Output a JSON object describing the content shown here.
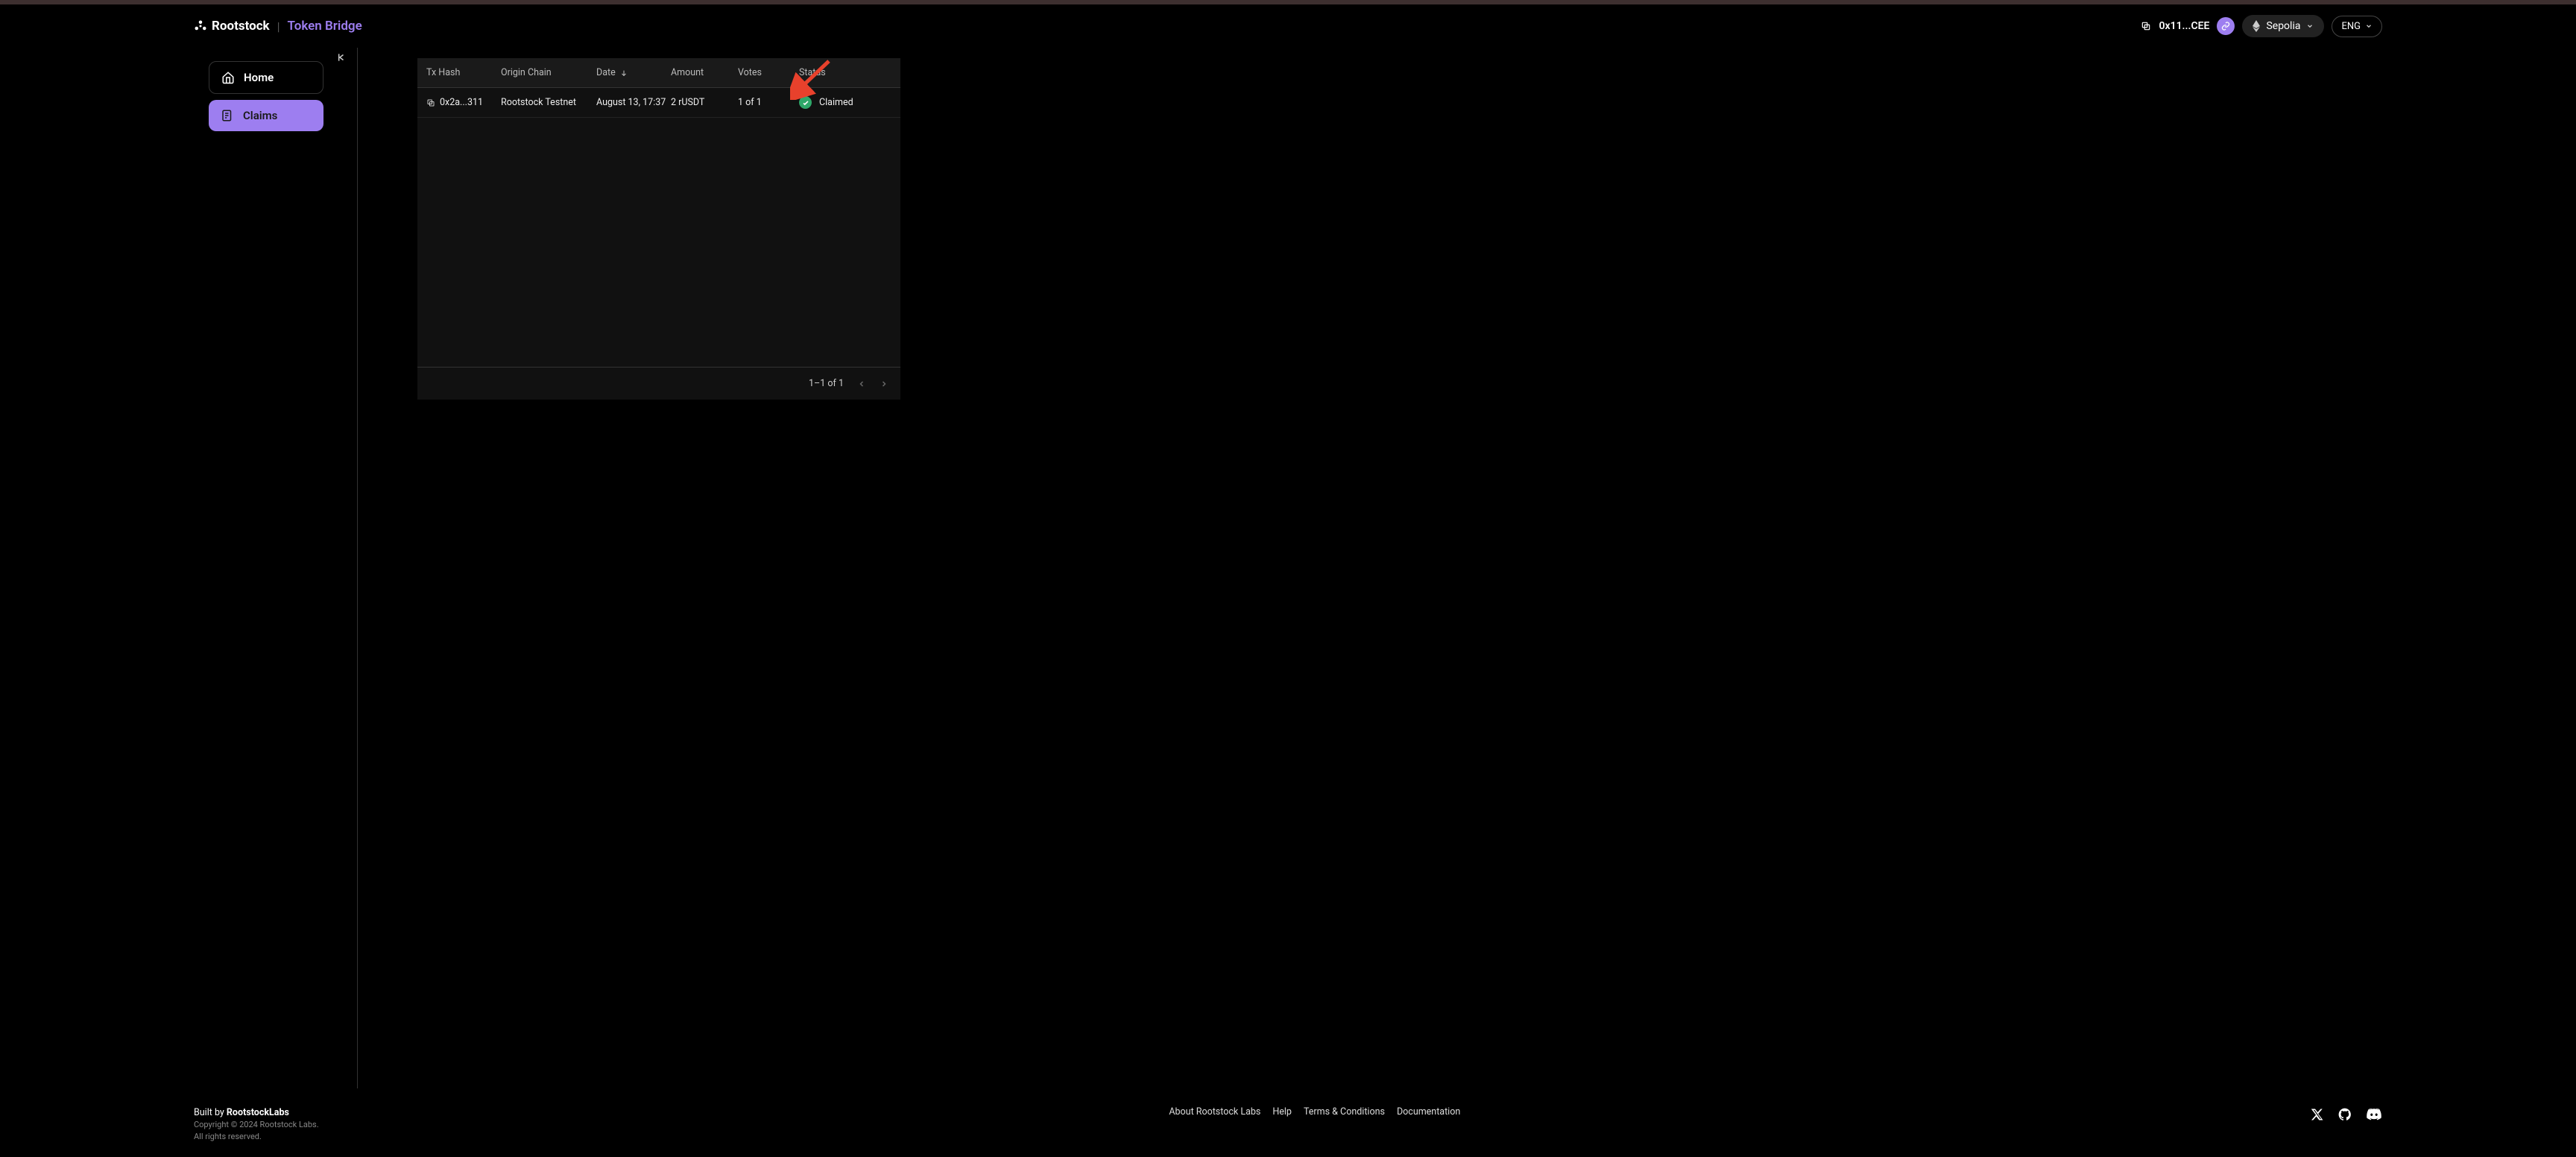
{
  "header": {
    "brand": "Rootstock",
    "app_name": "Token Bridge",
    "wallet_address": "0x11...CEE",
    "network_name": "Sepolia",
    "language": "ENG"
  },
  "sidebar": {
    "items": [
      {
        "label": "Home",
        "active": false
      },
      {
        "label": "Claims",
        "active": true
      }
    ]
  },
  "table": {
    "columns": {
      "tx_hash": "Tx Hash",
      "origin_chain": "Origin Chain",
      "date": "Date",
      "amount": "Amount",
      "votes": "Votes",
      "status": "Status"
    },
    "rows": [
      {
        "tx_hash": "0x2a...311",
        "origin_chain": "Rootstock Testnet",
        "date": "August 13, 17:37",
        "amount": "2 rUSDT",
        "votes": "1 of 1",
        "status": "Claimed"
      }
    ],
    "pagination": "1–1 of 1"
  },
  "footer": {
    "built_prefix": "Built by ",
    "built_brand": "RootstockLabs",
    "copyright": "Copyright © 2024 Rootstock Labs.",
    "rights": "All rights reserved.",
    "links": {
      "about": "About Rootstock Labs",
      "help": "Help",
      "terms": "Terms & Conditions",
      "docs": "Documentation"
    }
  }
}
